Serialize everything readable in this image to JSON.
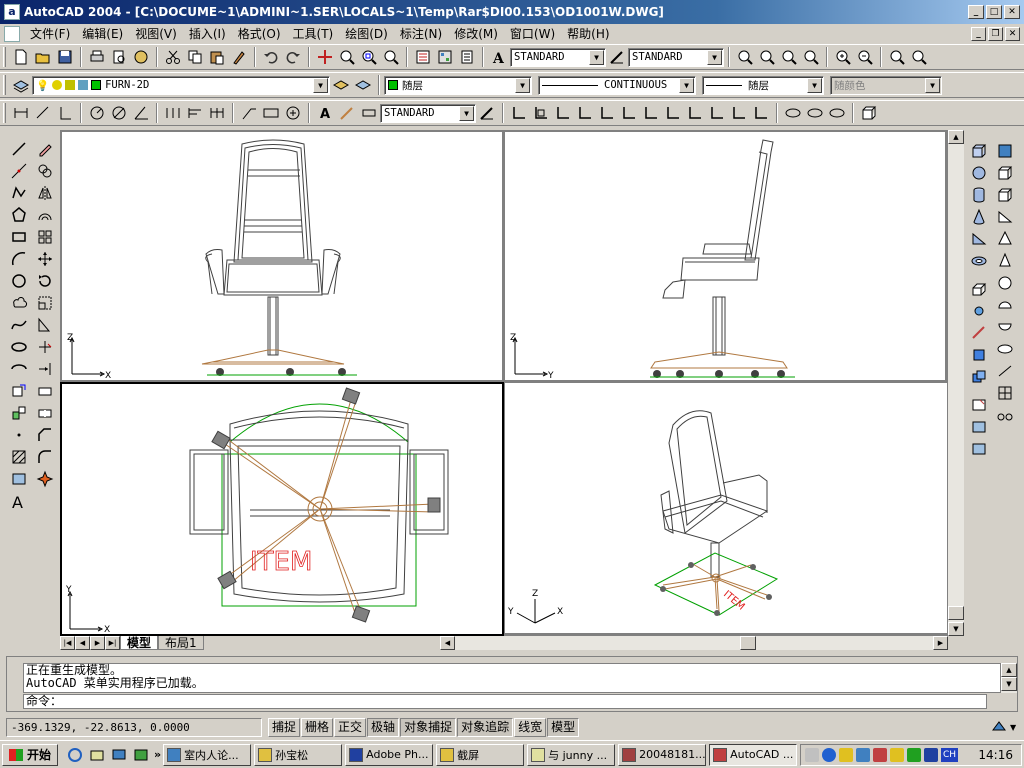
{
  "window": {
    "title": "AutoCAD 2004 - [C:\\DOCUME~1\\ADMINI~1.SER\\LOCALS~1\\Temp\\Rar$DI00.153\\OD1001W.DWG]",
    "app_icon": "a"
  },
  "menu": [
    "文件(F)",
    "编辑(E)",
    "视图(V)",
    "插入(I)",
    "格式(O)",
    "工具(T)",
    "绘图(D)",
    "标注(N)",
    "修改(M)",
    "窗口(W)",
    "帮助(H)"
  ],
  "toolbar_standard": {
    "text_style": "STANDARD",
    "dim_style": "STANDARD"
  },
  "toolbar_layers": {
    "layer": "FURN-2D",
    "color": "随层",
    "linetype": "CONTINUOUS",
    "lineweight": "随层",
    "plot_style": "随颜色"
  },
  "toolbar_dim": {
    "dim_style": "STANDARD"
  },
  "viewports": {
    "front": {
      "axis_x": "X",
      "axis_z": "Z"
    },
    "side": {
      "axis_y": "Y",
      "axis_z": "Z"
    },
    "top": {
      "axis_x": "X",
      "axis_y": "Y",
      "label": "ITEM"
    },
    "iso": {
      "axis_x": "X",
      "axis_y": "Y",
      "axis_z": "Z",
      "label": "ITEM"
    }
  },
  "layout_tabs": [
    "模型",
    "布局1"
  ],
  "command": {
    "lines": [
      "正在重生成模型。",
      "AutoCAD 菜单实用程序已加载。"
    ],
    "prompt": "命令："
  },
  "status": {
    "coords": "-369.1329,  -22.8613,  0.0000",
    "buttons": [
      "捕捉",
      "栅格",
      "正交",
      "极轴",
      "对象捕捉",
      "对象追踪",
      "线宽",
      "模型"
    ]
  },
  "taskbar": {
    "start": "开始",
    "tasks": [
      "室内人论...",
      "孙宝松",
      "Adobe Ph...",
      "截屏",
      "与 junny ...",
      "20048181...",
      "AutoCAD ..."
    ],
    "clock": "14:16",
    "lang": "CH"
  },
  "colors": {
    "titlebar": "#0a246a",
    "layer_green": "#00c000",
    "chair_base": "#b07840",
    "chair_wire": "#404040",
    "hatch_green": "#00a000",
    "item_red": "#e02020"
  }
}
